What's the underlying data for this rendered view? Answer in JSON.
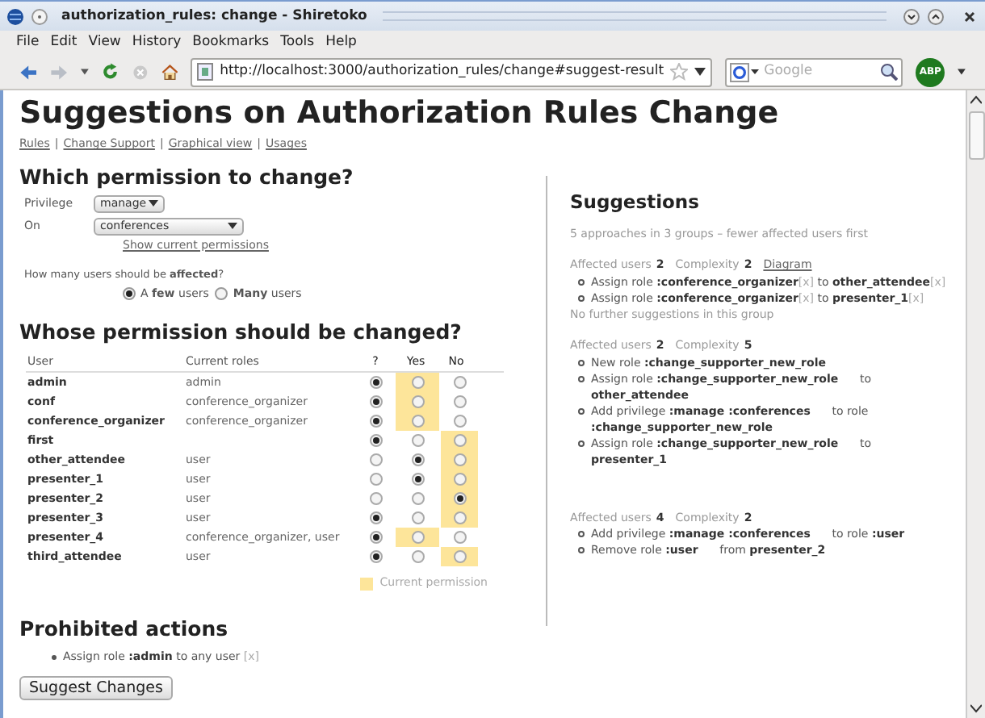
{
  "window": {
    "title": "authorization_rules: change - Shiretoko"
  },
  "menu": [
    "File",
    "Edit",
    "View",
    "History",
    "Bookmarks",
    "Tools",
    "Help"
  ],
  "address": {
    "value": "http://localhost:3000/authorization_rules/change#suggest-result"
  },
  "search": {
    "placeholder": "Google"
  },
  "addon_badge": "ABP",
  "page": {
    "title": "Suggestions on Authorization Rules Change",
    "nav_links": [
      "Rules",
      "Change Support",
      "Graphical view",
      "Usages"
    ],
    "nav_separators": [
      "|",
      "|",
      "|"
    ],
    "which": {
      "heading": "Which permission to change?",
      "privilege": {
        "label": "Privilege",
        "value": "manage"
      },
      "on": {
        "label": "On",
        "value": "conferences"
      },
      "show_link": "Show current permissions",
      "affected_question": "How many users should be **affected**?",
      "affected_options": [
        {
          "label": "A **few** users",
          "selected": true
        },
        {
          "label": "**Many** users",
          "selected": false
        }
      ]
    },
    "whose": {
      "heading": "Whose permission should be changed?",
      "columns": [
        "User",
        "Current roles",
        "?",
        "Yes",
        "No"
      ],
      "rows": [
        {
          "user": "admin",
          "roles": "admin",
          "radios": [
            {
              "selected": true
            },
            {
              "selected": false
            },
            {
              "selected": false
            }
          ],
          "current": true
        },
        {
          "user": "conf",
          "roles": "conference_organizer",
          "radios": [
            {
              "selected": true
            },
            {
              "selected": false
            },
            {
              "selected": false
            }
          ],
          "current": true
        },
        {
          "user": "conference_organizer",
          "roles": "conference_organizer",
          "radios": [
            {
              "selected": true
            },
            {
              "selected": false
            },
            {
              "selected": false
            }
          ],
          "current": true
        },
        {
          "user": "first",
          "radios": [
            {
              "selected": true
            },
            {
              "selected": false
            },
            {
              "selected": false
            }
          ],
          "current": false
        },
        {
          "user": "other_attendee",
          "roles": "user",
          "radios": [
            {
              "selected": false
            },
            {
              "selected": true
            },
            {
              "selected": false
            }
          ],
          "current": false
        },
        {
          "user": "presenter_1",
          "roles": "user",
          "radios": [
            {
              "selected": false
            },
            {
              "selected": true
            },
            {
              "selected": false
            }
          ],
          "current": false
        },
        {
          "user": "presenter_2",
          "roles": "user",
          "radios": [
            {
              "selected": false
            },
            {
              "selected": false
            },
            {
              "selected": true
            }
          ],
          "current": false
        },
        {
          "user": "presenter_3",
          "roles": "user",
          "radios": [
            {
              "selected": true
            },
            {
              "selected": false
            },
            {
              "selected": false
            }
          ],
          "current": false
        },
        {
          "user": "presenter_4",
          "roles": "conference_organizer, user",
          "radios": [
            {
              "selected": true
            },
            {
              "selected": false
            },
            {
              "selected": false
            }
          ],
          "current": true
        },
        {
          "user": "third_attendee",
          "roles": "user",
          "radios": [
            {
              "selected": true
            },
            {
              "selected": false
            },
            {
              "selected": false
            }
          ],
          "current": false
        }
      ],
      "legend": "Current permission"
    },
    "prohibited": {
      "heading": "Prohibited actions",
      "items": [
        [
          {
            "kind": "plain",
            "text": "Assign role "
          },
          {
            "kind": "bold",
            "text": ":admin"
          },
          {
            "kind": "plain",
            "text": " to any user "
          },
          {
            "kind": "remove",
            "text": "[x]"
          }
        ]
      ]
    },
    "submit": "Suggest Changes",
    "suggestions": {
      "heading": "Suggestions",
      "summary": "5 approaches in 3 groups – fewer affected users first",
      "groups": [
        {
          "affected_label": "Affected users",
          "affected": "2",
          "complexity_label": "Complexity",
          "complexity": "2",
          "diagram_link": "Diagram",
          "items": [
            [
              {
                "kind": "plain",
                "text": "Assign role "
              },
              {
                "kind": "bold",
                "text": ":conference_organizer"
              },
              {
                "kind": "remove",
                "text": "[x]"
              },
              {
                "kind": "plain",
                "text": " to "
              },
              {
                "kind": "bold",
                "text": "other_attendee"
              },
              {
                "kind": "remove",
                "text": "[x]"
              }
            ],
            [
              {
                "kind": "plain",
                "text": "Assign role "
              },
              {
                "kind": "bold",
                "text": ":conference_organizer"
              },
              {
                "kind": "remove",
                "text": "[x]"
              },
              {
                "kind": "plain",
                "text": " to "
              },
              {
                "kind": "bold",
                "text": "presenter_1"
              },
              {
                "kind": "remove",
                "text": "[x]"
              }
            ]
          ],
          "note": "No further suggestions in this group"
        },
        {
          "affected_label": "Affected users",
          "affected": "2",
          "complexity_label": "Complexity",
          "complexity": "5",
          "items": [
            [
              {
                "kind": "plain",
                "text": "New role "
              },
              {
                "kind": "bold",
                "text": ":change_supporter_new_role"
              }
            ],
            [
              {
                "kind": "plain",
                "text": "Assign role "
              },
              {
                "kind": "bold",
                "text": ":change_supporter_new_role"
              },
              {
                "kind": "plain",
                "text": "      to "
              },
              {
                "kind": "break"
              },
              {
                "kind": "bold",
                "text": "other_attendee"
              }
            ],
            [
              {
                "kind": "plain",
                "text": "Add privilege "
              },
              {
                "kind": "bold",
                "text": ":manage :conferences"
              },
              {
                "kind": "plain",
                "text": "      to role "
              },
              {
                "kind": "break"
              },
              {
                "kind": "bold",
                "text": ":change_supporter_new_role"
              }
            ],
            [
              {
                "kind": "plain",
                "text": "Assign role "
              },
              {
                "kind": "bold",
                "text": ":change_supporter_new_role"
              },
              {
                "kind": "plain",
                "text": "      to "
              },
              {
                "kind": "break"
              },
              {
                "kind": "bold",
                "text": "presenter_1"
              }
            ]
          ]
        },
        {
          "affected_label": "Affected users",
          "affected": "4",
          "complexity_label": "Complexity",
          "complexity": "2",
          "items": [
            [
              {
                "kind": "plain",
                "text": "Add privilege "
              },
              {
                "kind": "bold",
                "text": ":manage :conferences"
              },
              {
                "kind": "plain",
                "text": "      to role "
              },
              {
                "kind": "bold",
                "text": ":user"
              }
            ],
            [
              {
                "kind": "plain",
                "text": "Remove role "
              },
              {
                "kind": "bold",
                "text": ":user"
              },
              {
                "kind": "plain",
                "text": "      from "
              },
              {
                "kind": "bold",
                "text": "presenter_2"
              }
            ]
          ]
        }
      ]
    }
  }
}
